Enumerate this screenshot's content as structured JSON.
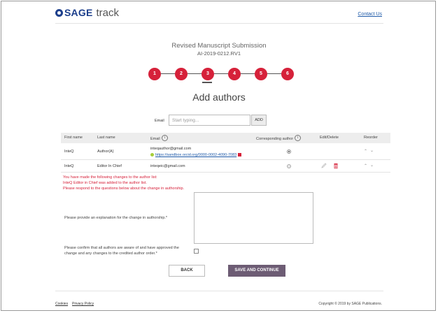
{
  "header": {
    "logo_sage": "SAGE",
    "logo_track": "track",
    "contact": "Contact Us"
  },
  "submission": {
    "title": "Revised Manuscript Submission",
    "id": "AI-2019-0212.RV1"
  },
  "stepper": {
    "steps": [
      "1",
      "2",
      "3",
      "4",
      "5",
      "6"
    ],
    "active": 3
  },
  "page_heading": "Add authors",
  "email_add": {
    "label": "Email",
    "placeholder": "Start typing...",
    "button": "ADD"
  },
  "table": {
    "headers": {
      "first_name": "First name",
      "last_name": "Last name",
      "email": "Email",
      "corresponding": "Corresponding author",
      "edit_delete": "Edit/Delete",
      "reorder": "Reorder"
    },
    "info_glyph": "i",
    "rows": [
      {
        "first_name": "InteQ",
        "last_name": "Author(A)",
        "email": "inteqauthor@gmail.com",
        "orcid": "https://sandbox.orcid.org/0000-0002-4090-7083",
        "corresponding": true
      },
      {
        "first_name": "InteQ",
        "last_name": "Editor In Chief",
        "email": "inteqeic@gmail.com",
        "orcid": "",
        "corresponding": false
      }
    ]
  },
  "messages": [
    "You have made the following changes to the author list:",
    "InteQ Editor in Chief was added to the author list.",
    "Please respond to the questions below about the change in authorship."
  ],
  "questions": {
    "explanation": "Please provide an explanation for the change in authorship.*",
    "confirm_line1": "Please confirm that all authors are aware of and have approved the",
    "confirm_line2": "change and any changes to the credited author order.*"
  },
  "buttons": {
    "back": "BACK",
    "save": "SAVE AND CONTINUE"
  },
  "footer": {
    "cookies": "Cookies",
    "privacy": "Privacy Policy",
    "copyright": "Copyright © 2019 by SAGE Publications."
  },
  "colors": {
    "accent_red": "#d6213a",
    "save_button": "#6d5c74",
    "brand_blue": "#1d3f8c"
  }
}
